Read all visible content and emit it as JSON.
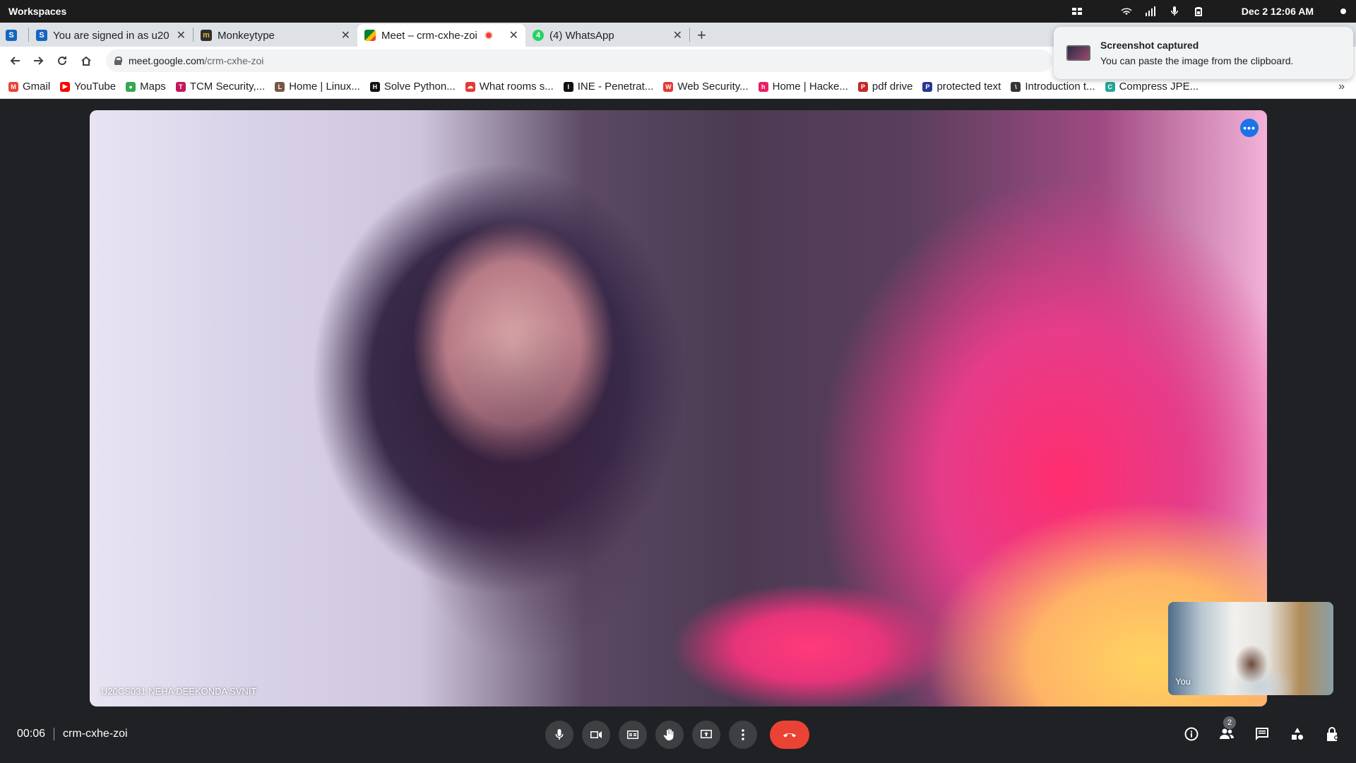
{
  "os_bar": {
    "workspaces_label": "Workspaces",
    "clock": "Dec 2  12:06 AM",
    "tray_icons": [
      "grid-icon",
      "wifi-icon",
      "signal-icon",
      "mic-icon",
      "battery-icon"
    ]
  },
  "tabs": [
    {
      "title": "",
      "favicon_text": "S",
      "favicon_color": "#1565c0",
      "pinned": true
    },
    {
      "title": "You are signed in as u20",
      "favicon_text": "S",
      "favicon_color": "#1565c0"
    },
    {
      "title": "Monkeytype",
      "favicon_text": "m",
      "favicon_color": "#2c2e31"
    },
    {
      "title": "Meet – crm-cxhe-zoi",
      "favicon_text": "",
      "favicon_color": "#00832d",
      "active": true,
      "recording": true
    },
    {
      "title": "(4) WhatsApp",
      "favicon_text": "4",
      "favicon_color": "#25d366"
    }
  ],
  "toolbar": {
    "url_host": "meet.google.com",
    "url_path": "/crm-cxhe-zoi"
  },
  "bookmarks": [
    {
      "label": "Gmail",
      "color": "#ea4335",
      "text": "M"
    },
    {
      "label": "YouTube",
      "color": "#ff0000",
      "text": "▶"
    },
    {
      "label": "Maps",
      "color": "#34a853",
      "text": "●"
    },
    {
      "label": "TCM Security,...",
      "color": "#c2185b",
      "text": "T"
    },
    {
      "label": "Home | Linux...",
      "color": "#795548",
      "text": "L"
    },
    {
      "label": "Solve Python...",
      "color": "#111111",
      "text": "H"
    },
    {
      "label": "What rooms s...",
      "color": "#e53935",
      "text": "☁"
    },
    {
      "label": "INE - Penetrat...",
      "color": "#111111",
      "text": "I"
    },
    {
      "label": "Web Security...",
      "color": "#e53935",
      "text": "W"
    },
    {
      "label": "Home | Hacke...",
      "color": "#e91e63",
      "text": "h"
    },
    {
      "label": "pdf drive",
      "color": "#c62828",
      "text": "P"
    },
    {
      "label": "protected text",
      "color": "#283593",
      "text": "P"
    },
    {
      "label": "Introduction t...",
      "color": "#333333",
      "text": "\\"
    },
    {
      "label": "Compress JPE...",
      "color": "#26a69a",
      "text": "C"
    }
  ],
  "bookmarks_more": "»",
  "notification": {
    "title": "Screenshot captured",
    "body": "You can paste the image from the clipboard."
  },
  "meet": {
    "main_participant_name": "U20CS031 NEHA DEEKONDA SVNIT",
    "self_label": "You",
    "elapsed_time": "00:06",
    "meeting_code": "crm-cxhe-zoi",
    "participants_count": "2"
  }
}
